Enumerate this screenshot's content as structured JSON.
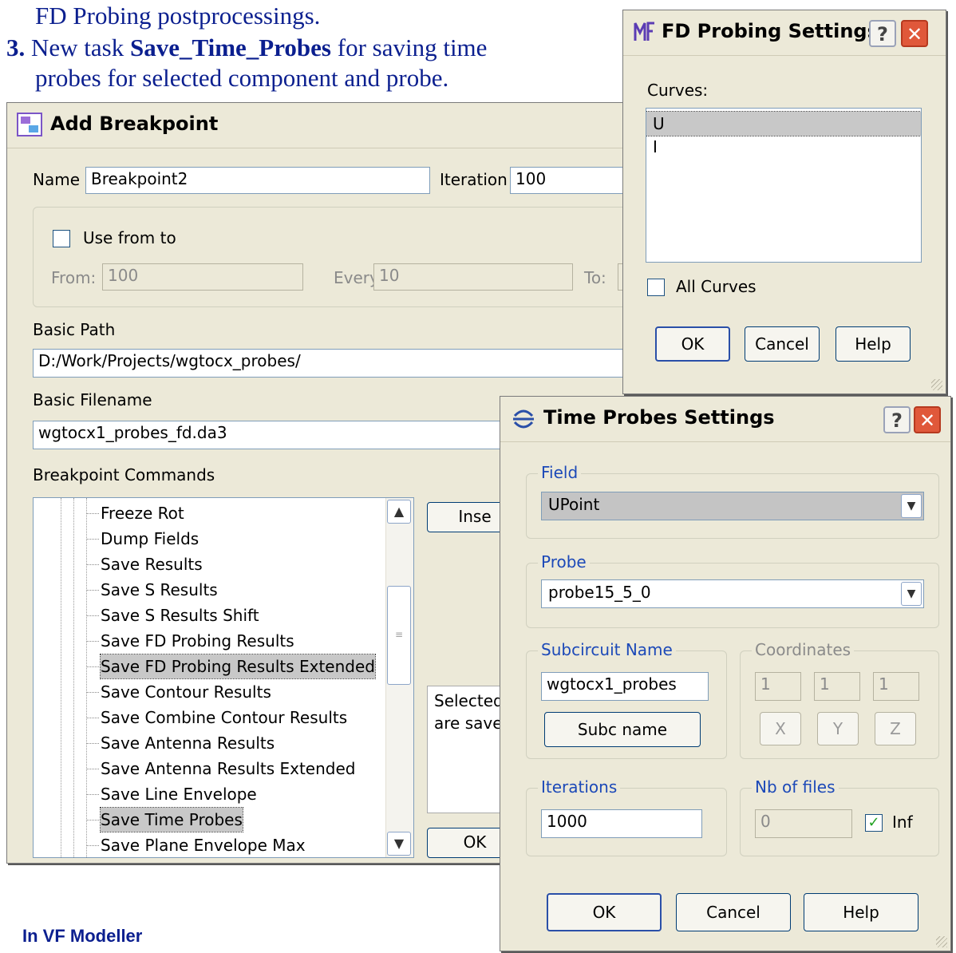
{
  "slide": {
    "line1": "FD Probing postprocessings.",
    "line2_number": "3.",
    "line2_pre": "New task ",
    "line2_task": "Save_Time_Probes",
    "line2_post": " for saving time",
    "line3": "probes for selected component and probe.",
    "footer": "In VF Modeller"
  },
  "add_breakpoint": {
    "title": "Add Breakpoint",
    "name_label": "Name",
    "name_value": "Breakpoint2",
    "iteration_label": "Iteration",
    "iteration_value": "100",
    "use_from_to_label": "Use from to",
    "from_label": "From:",
    "from_value": "100",
    "every_label": "Every:",
    "every_value": "10",
    "to_label": "To:",
    "basic_path_label": "Basic Path",
    "basic_path_value": "D:/Work/Projects/wgtocx_probes/",
    "basic_filename_label": "Basic Filename",
    "basic_filename_value": "wgtocx1_probes_fd.da3",
    "commands_label": "Breakpoint Commands",
    "commands": [
      "Freeze Rot",
      "Dump Fields",
      "Save Results",
      "Save S Results",
      "Save S Results Shift",
      "Save FD Probing Results",
      "Save FD Probing Results Extended",
      "Save Contour Results",
      "Save Combine Contour Results",
      "Save Antenna Results",
      "Save Antenna Results Extended",
      "Save Line Envelope",
      "Save Time Probes",
      "Save Plane Envelope Max"
    ],
    "selected_commands": [
      "Save FD Probing Results Extended",
      "Save Time Probes"
    ],
    "insert_button": "Inse",
    "ok_button": "OK",
    "desc_line1": "Selected",
    "desc_line2": "are saved"
  },
  "fd_probing": {
    "title": "FD Probing Settings",
    "curves_label": "Curves:",
    "curves": [
      "U",
      "I"
    ],
    "selected_curve": "U",
    "all_curves_label": "All Curves",
    "ok": "OK",
    "cancel": "Cancel",
    "help": "Help"
  },
  "time_probes": {
    "title": "Time Probes Settings",
    "field_label": "Field",
    "field_value": "UPoint",
    "probe_label": "Probe",
    "probe_value": "probe15_5_0",
    "subcircuit_label": "Subcircuit Name",
    "subcircuit_value": "wgtocx1_probes",
    "subc_button": "Subc name",
    "coordinates_label": "Coordinates",
    "coord_values": [
      "1",
      "1",
      "1"
    ],
    "coord_buttons": [
      "X",
      "Y",
      "Z"
    ],
    "iterations_label": "Iterations",
    "iterations_value": "1000",
    "nb_files_label": "Nb of files",
    "nb_files_value": "0",
    "inf_label": "Inf",
    "inf_checked": true,
    "ok": "OK",
    "cancel": "Cancel",
    "help": "Help"
  },
  "colors": {
    "slide_text": "#0b1f8f",
    "dialog_bg": "#ece9d8",
    "close_button": "#e0583a",
    "group_label_blue": "#1c49b8"
  }
}
